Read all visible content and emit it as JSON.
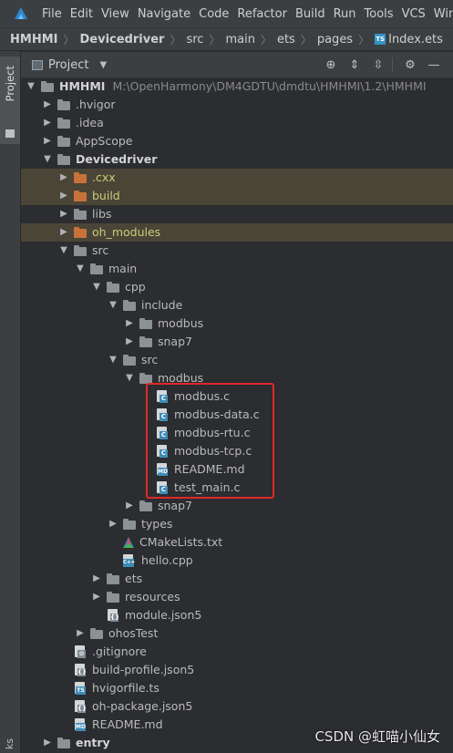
{
  "menubar": {
    "items": [
      {
        "label": "File"
      },
      {
        "label": "Edit"
      },
      {
        "label": "View"
      },
      {
        "label": "Navigate"
      },
      {
        "label": "Code"
      },
      {
        "label": "Refactor"
      },
      {
        "label": "Build"
      },
      {
        "label": "Run"
      },
      {
        "label": "Tools"
      },
      {
        "label": "VCS"
      },
      {
        "label": "Win"
      }
    ]
  },
  "breadcrumb": {
    "items": [
      "HMHMI",
      "Devicedriver",
      "src",
      "main",
      "ets",
      "pages",
      "Index.ets"
    ],
    "file_badge": "TS"
  },
  "side": {
    "project_tab": "Project",
    "bottom_label": "ks"
  },
  "panel": {
    "title": "Project"
  },
  "tree": {
    "root_name": "HMHMI",
    "root_path": "M:\\OpenHarmony\\DM4GDTU\\dmdtu\\HMHMI\\1.2\\HMHMI",
    "nodes": [
      {
        "label": ".hvigor"
      },
      {
        "label": ".idea"
      },
      {
        "label": "AppScope"
      },
      {
        "label": "Devicedriver"
      },
      {
        "label": ".cxx"
      },
      {
        "label": "build"
      },
      {
        "label": "libs"
      },
      {
        "label": "oh_modules"
      },
      {
        "label": "src"
      },
      {
        "label": "main"
      },
      {
        "label": "cpp"
      },
      {
        "label": "include"
      },
      {
        "label": "modbus"
      },
      {
        "label": "snap7"
      },
      {
        "label": "src"
      },
      {
        "label": "modbus"
      },
      {
        "label": "modbus.c"
      },
      {
        "label": "modbus-data.c"
      },
      {
        "label": "modbus-rtu.c"
      },
      {
        "label": "modbus-tcp.c"
      },
      {
        "label": "README.md"
      },
      {
        "label": "test_main.c"
      },
      {
        "label": "snap7"
      },
      {
        "label": "types"
      },
      {
        "label": "CMakeLists.txt"
      },
      {
        "label": "hello.cpp"
      },
      {
        "label": "ets"
      },
      {
        "label": "resources"
      },
      {
        "label": "module.json5"
      },
      {
        "label": "ohosTest"
      },
      {
        "label": ".gitignore"
      },
      {
        "label": "build-profile.json5"
      },
      {
        "label": "hvigorfile.ts"
      },
      {
        "label": "oh-package.json5"
      },
      {
        "label": "README.md"
      },
      {
        "label": "entry"
      }
    ]
  },
  "icon_letters": {
    "c": "C",
    "md": "MD",
    "ts": "TS",
    "cpp": "C++"
  },
  "watermark": "CSDN @虹喵小仙女"
}
